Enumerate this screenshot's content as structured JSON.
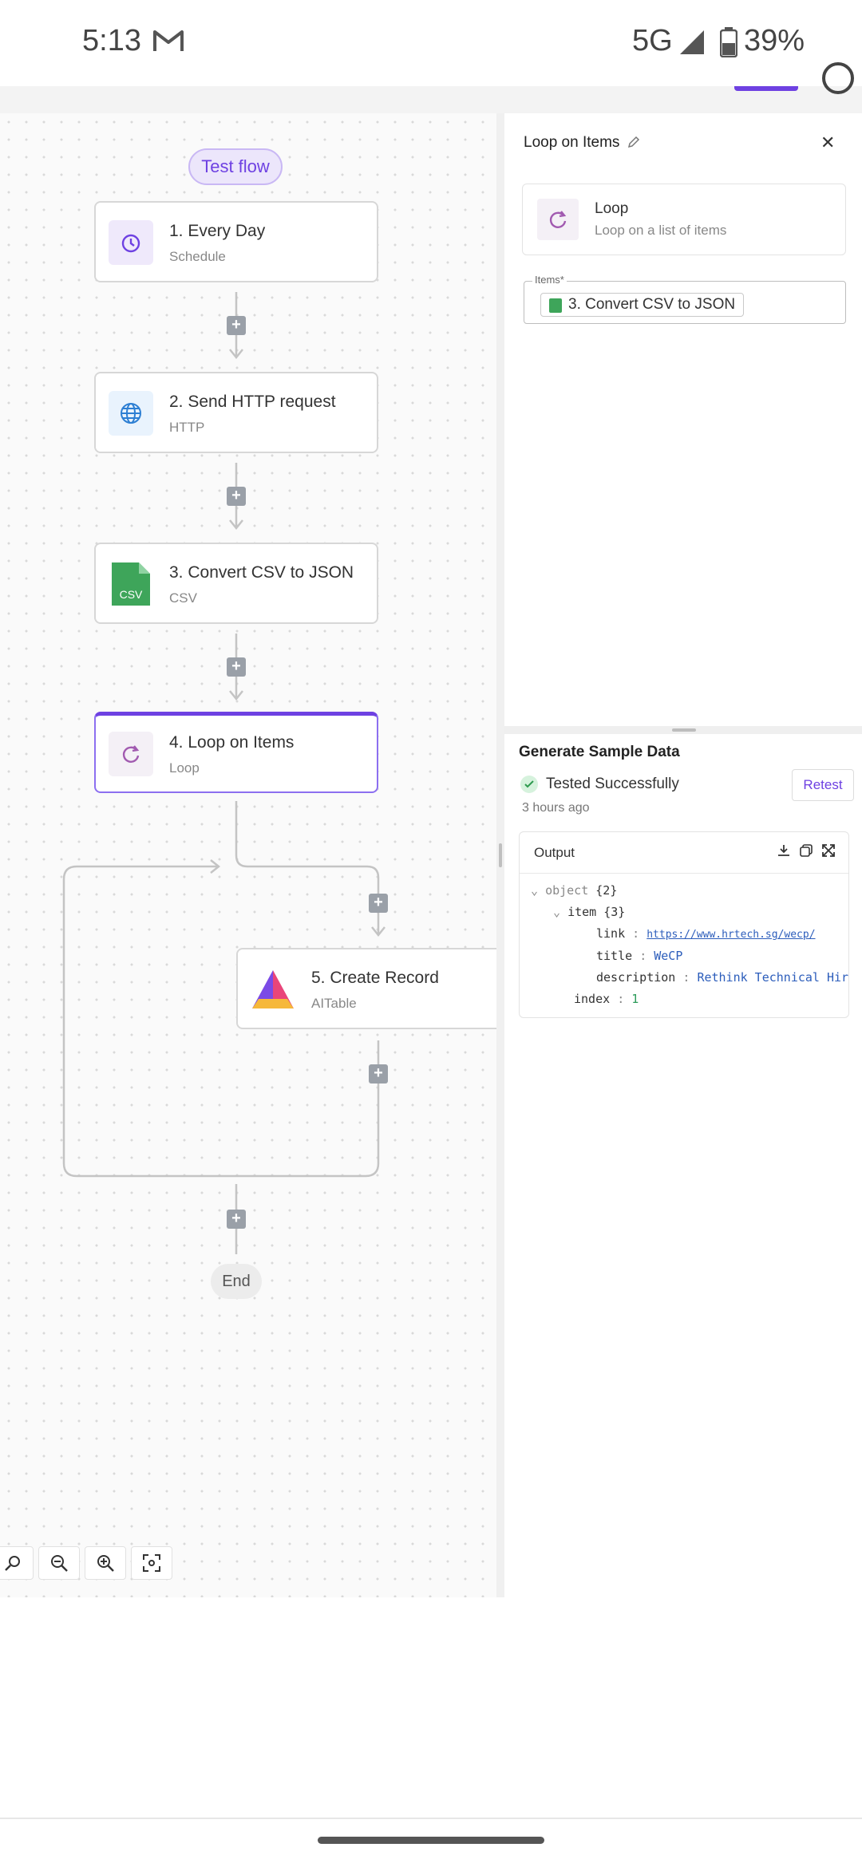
{
  "status_bar": {
    "time": "5:13",
    "network": "5G",
    "battery": "39%"
  },
  "canvas": {
    "test_flow_label": "Test flow",
    "steps": [
      {
        "title": "1. Every Day",
        "subtitle": "Schedule"
      },
      {
        "title": "2. Send HTTP request",
        "subtitle": "HTTP"
      },
      {
        "title": "3. Convert CSV to JSON",
        "subtitle": "CSV",
        "icon_text": "CSV"
      },
      {
        "title": "4. Loop on Items",
        "subtitle": "Loop"
      },
      {
        "title": "5. Create Record",
        "subtitle": "AITable"
      }
    ],
    "end_label": "End"
  },
  "panel": {
    "title": "Loop on Items",
    "piece": {
      "name": "Loop",
      "description": "Loop on a list of items"
    },
    "items_field": {
      "label": "Items*",
      "value": "3. Convert CSV to JSON"
    },
    "sample": {
      "title": "Generate Sample Data",
      "status": "Tested Successfully",
      "retest_label": "Retest",
      "time_ago": "3 hours ago"
    },
    "output": {
      "title": "Output",
      "root_key": "object",
      "root_count": "{2}",
      "item_key": "item",
      "item_count": "{3}",
      "link_key": "link",
      "link_value": "https://www.hrtech.sg/wecp/",
      "title_key": "title",
      "title_value": "WeCP",
      "description_key": "description",
      "description_value": "Rethink Technical Hir",
      "index_key": "index",
      "index_value": "1"
    }
  },
  "colors": {
    "accent": "#6e41e2",
    "csv_green": "#3ea55a",
    "success": "#2e9a4e"
  }
}
